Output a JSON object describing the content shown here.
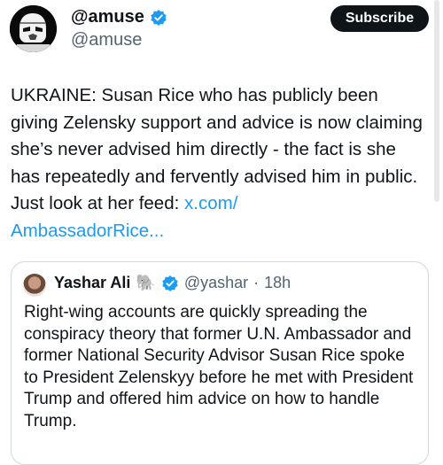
{
  "tweet": {
    "author_name": "@amuse",
    "author_handle": "@amuse",
    "subscribe_label": "Subscribe",
    "text": "UKRAINE: Susan Rice who has publicly been giving Zelensky support and advice is now claiming she’s never advised him directly - the fact is she has repeatedly and fervently advised him in public. Just look at her feed: ",
    "link_text": "x.com/\nAmbassadorRice..."
  },
  "quoted": {
    "author_name": "Yashar Ali",
    "emoji": "🐘",
    "author_handle": "@yashar",
    "separator": "·",
    "time": "18h",
    "text": "Right-wing accounts are quickly spreading the conspiracy theory that former U.N. Ambassador and former National Security Advisor Susan Rice spoke to President Zelenskyy before he met with President Trump and offered him advice on how to handle Trump."
  },
  "colors": {
    "link": "#1d9bf0",
    "verified": "#1d9bf0",
    "secondary_text": "#536471"
  }
}
